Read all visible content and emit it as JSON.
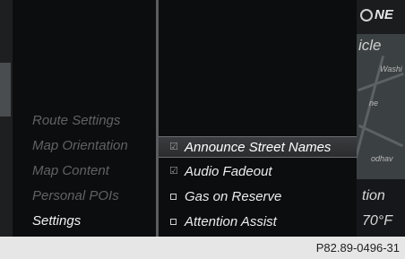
{
  "map": {
    "compass": "NE",
    "top_text": "icle",
    "street_label_1": "Washi",
    "street_label_2": "ne",
    "street_label_3": "odhav",
    "bottom_text_1": "tion",
    "bottom_text_2": "70°F"
  },
  "menu": {
    "items": [
      {
        "label": "Route Settings",
        "active": false
      },
      {
        "label": "Map Orientation",
        "active": false
      },
      {
        "label": "Map Content",
        "active": false
      },
      {
        "label": "Personal POIs",
        "active": false
      },
      {
        "label": "Settings",
        "active": true
      }
    ]
  },
  "submenu": {
    "items": [
      {
        "label": "Announce Street Names",
        "checked": true,
        "selected": true
      },
      {
        "label": "Audio Fadeout",
        "checked": true,
        "selected": false
      },
      {
        "label": "Gas on Reserve",
        "checked": false,
        "selected": false
      },
      {
        "label": "Attention Assist",
        "checked": false,
        "selected": false
      }
    ]
  },
  "footer": {
    "code": "P82.89-0496-31"
  }
}
